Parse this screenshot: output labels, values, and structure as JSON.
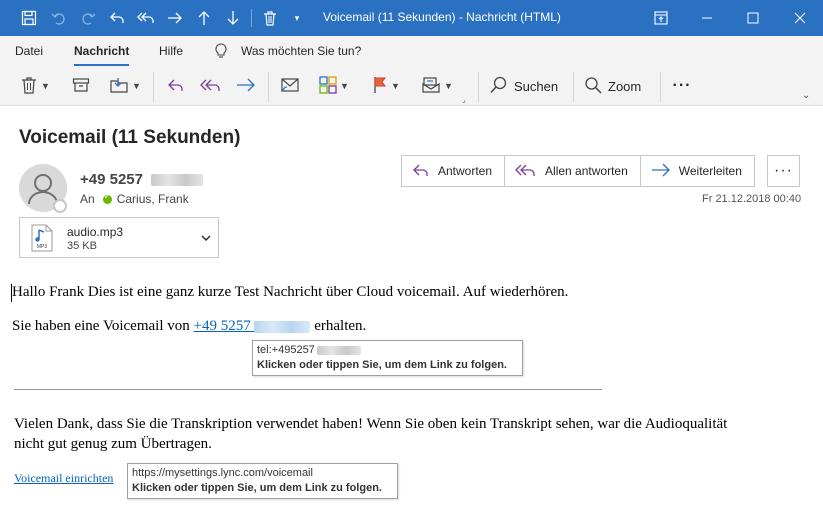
{
  "window": {
    "title": "Voicemail (11 Sekunden)  -  Nachricht (HTML)"
  },
  "menu": {
    "items": [
      "Datei",
      "Nachricht",
      "Hilfe"
    ],
    "tell_me": "Was möchten Sie tun?"
  },
  "ribbon": {
    "search_label": "Suchen",
    "zoom_label": "Zoom",
    "more_label": "···"
  },
  "message": {
    "subject": "Voicemail (11 Sekunden)",
    "sender": "+49 5257",
    "to_label": "An",
    "recipient": "Carius, Frank",
    "date": "Fr 21.12.2018 00:40",
    "actions": {
      "reply": "Antworten",
      "reply_all": "Allen antworten",
      "forward": "Weiterleiten",
      "more": "···"
    },
    "attachment": {
      "name": "audio.mp3",
      "size": "35 KB",
      "icon_label": "MP3"
    }
  },
  "body": {
    "line1": "Hallo Frank Dies ist eine ganz kurze Test Nachricht über Cloud voicemail. Auf wiederhören.",
    "line2_prefix": "Sie haben eine Voicemail von ",
    "line2_link": "+49 5257",
    "line2_suffix": " erhalten.",
    "tooltip1_url": "tel:+495257",
    "tooltip1_hint": "Klicken oder tippen Sie, um dem Link zu folgen.",
    "thanks_line1": "Vielen Dank, dass Sie die Transkription verwendet haben! Wenn Sie oben kein Transkript sehen, war die Audioqualität",
    "thanks_line2": "nicht gut genug zum Übertragen.",
    "setup_link": "Voicemail einrichten",
    "tooltip2_url": "https://mysettings.lync.com/voicemail",
    "tooltip2_hint": "Klicken oder tippen Sie, um dem Link zu folgen."
  },
  "colors": {
    "titlebar": "#2b71c2",
    "link": "#0563c1",
    "action_icon": "#7a3e9d",
    "forward_icon": "#2b71c2"
  }
}
